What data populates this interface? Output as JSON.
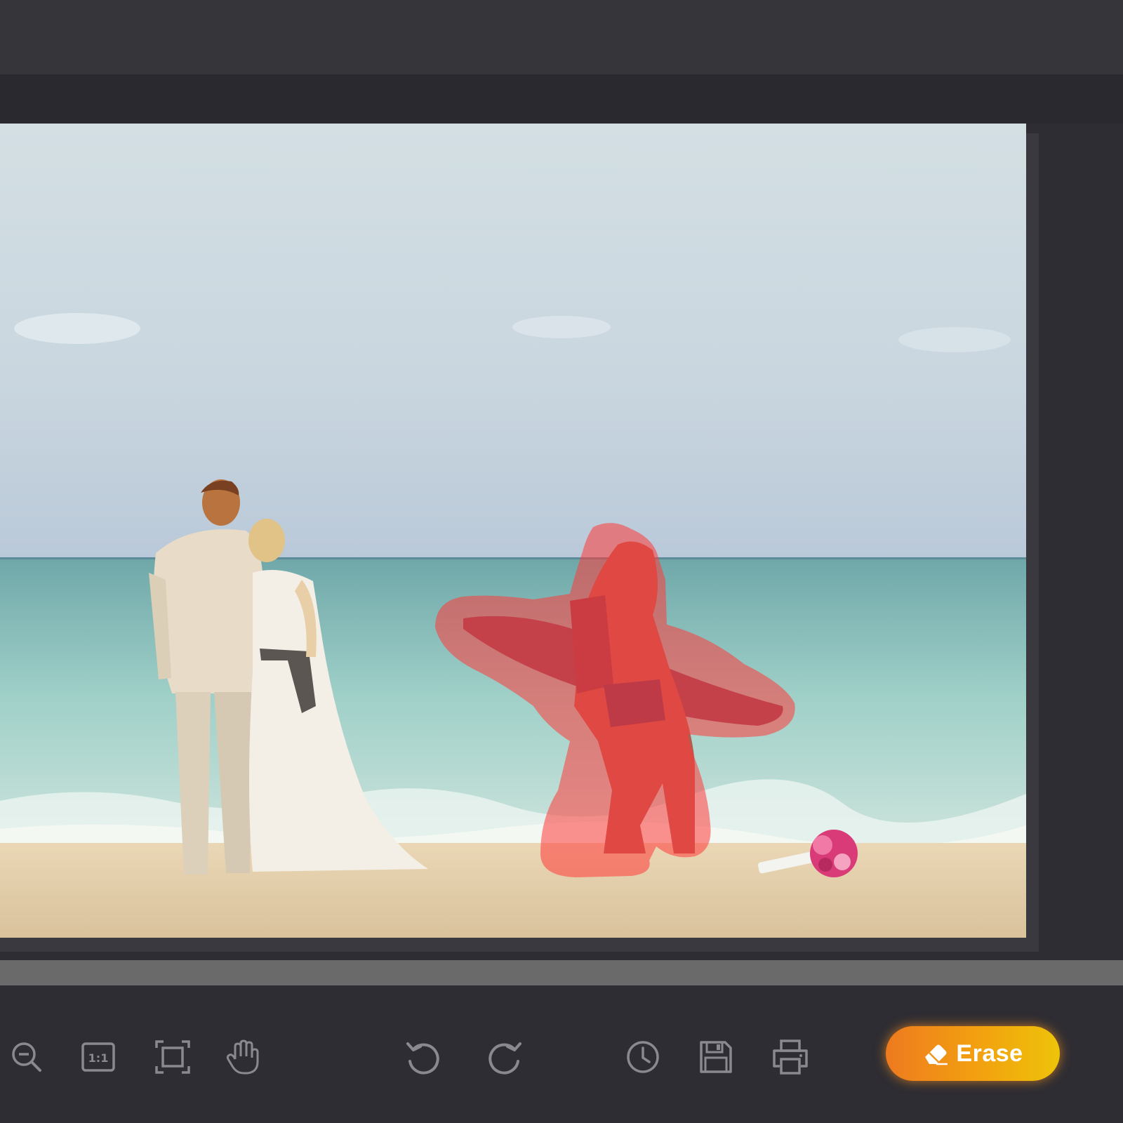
{
  "toolbar": {
    "tools": [
      {
        "name": "zoom-out-icon"
      },
      {
        "name": "actual-size-icon",
        "label": "1:1"
      },
      {
        "name": "fit-to-screen-icon"
      },
      {
        "name": "hand-pan-icon"
      },
      {
        "name": "undo-icon"
      },
      {
        "name": "redo-icon"
      },
      {
        "name": "history-icon"
      },
      {
        "name": "save-icon"
      },
      {
        "name": "print-icon"
      }
    ],
    "erase_label": "Erase"
  },
  "colors": {
    "accent_start": "#ee7a1f",
    "accent_end": "#eec30a",
    "selection_mask": "#ff3b3b",
    "icon": "#8a8990"
  }
}
